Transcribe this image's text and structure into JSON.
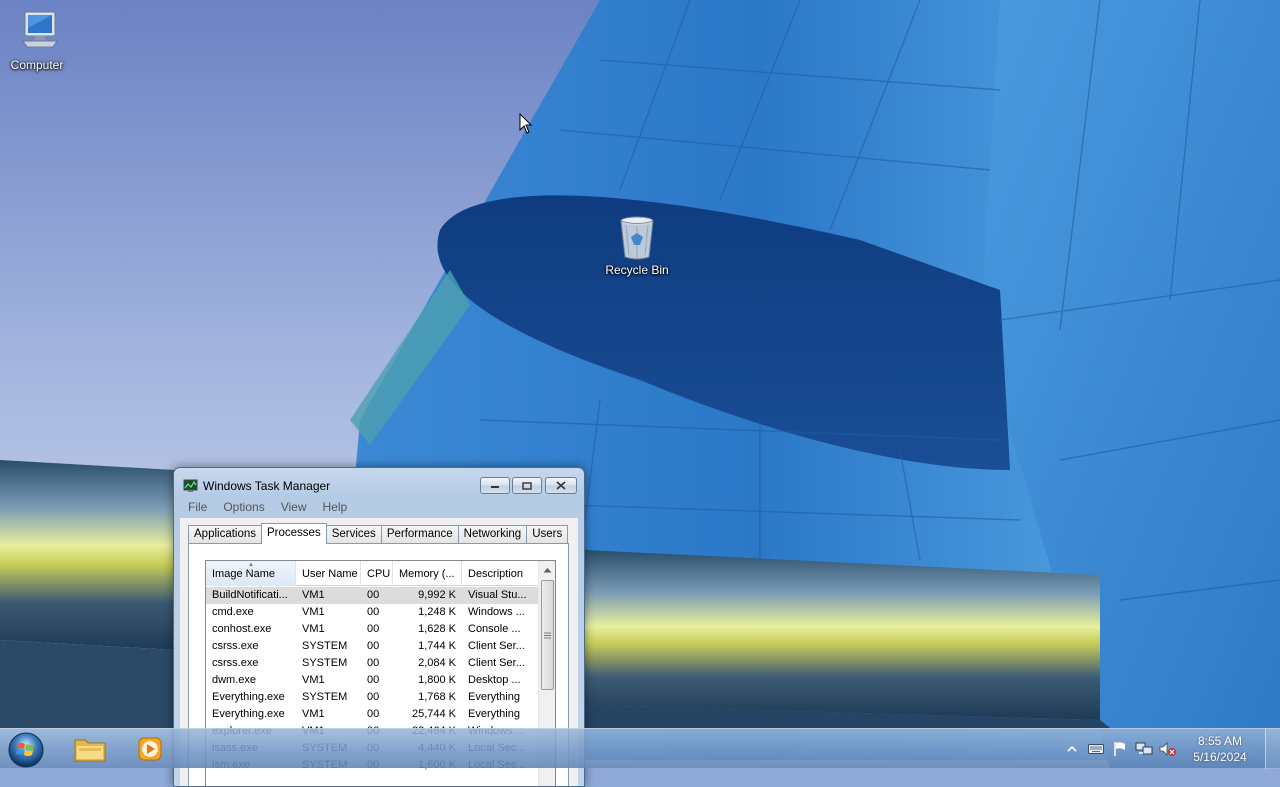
{
  "desktop": {
    "icons": [
      {
        "label": "Computer",
        "icon": "computer-icon"
      },
      {
        "label": "Recycle Bin",
        "icon": "recycle-bin-icon"
      }
    ]
  },
  "task_manager": {
    "title": "Windows Task Manager",
    "menu": [
      "File",
      "Options",
      "View",
      "Help"
    ],
    "tabs": [
      "Applications",
      "Processes",
      "Services",
      "Performance",
      "Networking",
      "Users"
    ],
    "active_tab": "Processes",
    "columns": [
      "Image Name",
      "User Name",
      "CPU",
      "Memory (...",
      "Description"
    ],
    "sorted_column": "Image Name",
    "rows": [
      {
        "name": "BuildNotificati...",
        "user": "VM1",
        "cpu": "00",
        "memory": "9,992 K",
        "description": "Visual Stu..."
      },
      {
        "name": "cmd.exe",
        "user": "VM1",
        "cpu": "00",
        "memory": "1,248 K",
        "description": "Windows ..."
      },
      {
        "name": "conhost.exe",
        "user": "VM1",
        "cpu": "00",
        "memory": "1,628 K",
        "description": "Console ..."
      },
      {
        "name": "csrss.exe",
        "user": "SYSTEM",
        "cpu": "00",
        "memory": "1,744 K",
        "description": "Client Ser..."
      },
      {
        "name": "csrss.exe",
        "user": "SYSTEM",
        "cpu": "00",
        "memory": "2,084 K",
        "description": "Client Ser..."
      },
      {
        "name": "dwm.exe",
        "user": "VM1",
        "cpu": "00",
        "memory": "1,800 K",
        "description": "Desktop ..."
      },
      {
        "name": "Everything.exe",
        "user": "SYSTEM",
        "cpu": "00",
        "memory": "1,768 K",
        "description": "Everything"
      },
      {
        "name": "Everything.exe",
        "user": "VM1",
        "cpu": "00",
        "memory": "25,744 K",
        "description": "Everything"
      },
      {
        "name": "explorer.exe",
        "user": "VM1",
        "cpu": "00",
        "memory": "22,464 K",
        "description": "Windows ..."
      },
      {
        "name": "lsass.exe",
        "user": "SYSTEM",
        "cpu": "00",
        "memory": "4,440 K",
        "description": "Local Sec..."
      },
      {
        "name": "lsm.exe",
        "user": "SYSTEM",
        "cpu": "00",
        "memory": "1,600 K",
        "description": "Local Ses..."
      }
    ]
  },
  "taskbar": {
    "pinned": [
      {
        "name": "windows-explorer",
        "icon": "folder-icon"
      },
      {
        "name": "media-player",
        "icon": "media-player-icon"
      }
    ],
    "tray": [
      "show-hidden-icons-icon",
      "keyboard-icon",
      "action-center-flag-icon",
      "network-icon",
      "volume-muted-icon"
    ],
    "clock": {
      "time": "8:55 AM",
      "date": "5/16/2024"
    }
  },
  "colors": {
    "taskbar": "#7c9bc8",
    "selection": "#dcdcdc",
    "wallpaper_building": "#2f7fd0"
  }
}
